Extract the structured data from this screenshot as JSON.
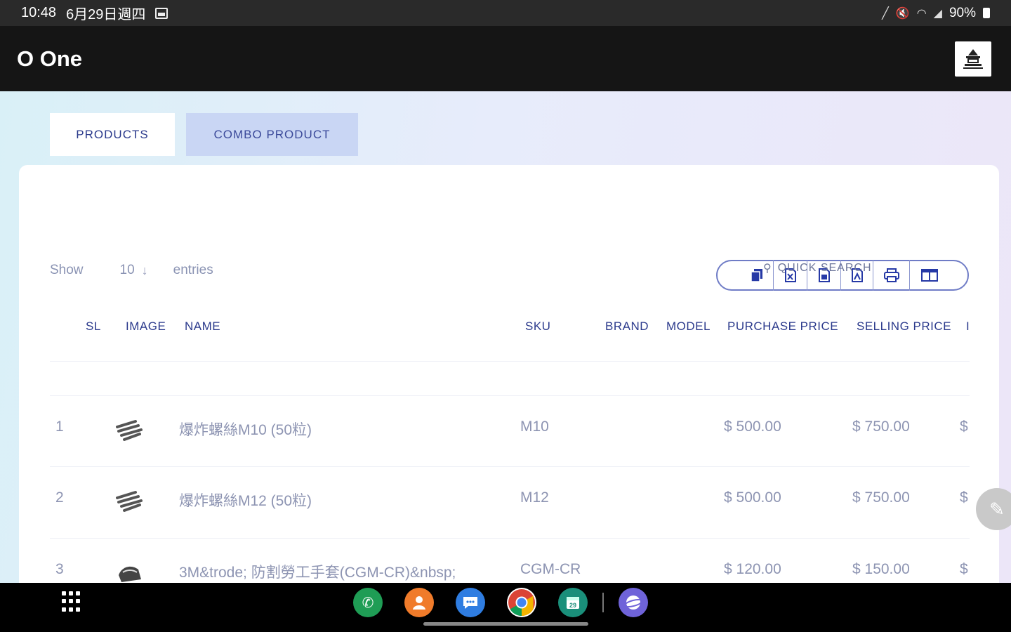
{
  "status_bar": {
    "time": "10:48",
    "date": "6月29日週四",
    "battery": "90%",
    "icons": [
      "gallery-icon",
      "mute-icon",
      "wifi-icon",
      "signal-icon",
      "battery-icon"
    ]
  },
  "header": {
    "title": "O One"
  },
  "tabs": [
    {
      "label": "PRODUCTS",
      "active": true
    },
    {
      "label": "COMBO PRODUCT",
      "active": false
    }
  ],
  "table_controls": {
    "show_label": "Show",
    "entries_value": "10",
    "entries_label": "entries",
    "search_placeholder": "QUICK SEARCH",
    "tools": [
      "copy-icon",
      "excel-icon",
      "csv-icon",
      "pdf-icon",
      "print-icon",
      "columns-icon"
    ]
  },
  "table": {
    "headers": [
      "SL",
      "IMAGE",
      "NAME",
      "SKU",
      "BRAND",
      "MODEL",
      "PURCHASE PRICE",
      "SELLING PRICE",
      "I"
    ],
    "rows": [
      {
        "sl": "1",
        "name": "爆炸螺絲M10 (50粒)",
        "sku": "M10",
        "brand": "",
        "model": "",
        "purchase_price": "$ 500.00",
        "selling_price": "$ 750.00",
        "more": "$"
      },
      {
        "sl": "2",
        "name": "爆炸螺絲M12 (50粒)",
        "sku": "M12",
        "brand": "",
        "model": "",
        "purchase_price": "$ 500.00",
        "selling_price": "$ 750.00",
        "more": "$"
      },
      {
        "sl": "3",
        "name": "3M&trode; 防割勞工手套(CGM-CR)&nbsp;",
        "sku": "CGM-CR",
        "brand": "",
        "model": "",
        "purchase_price": "$ 120.00",
        "selling_price": "$ 150.00",
        "more": "$"
      }
    ]
  },
  "nav_bar": {
    "dock_apps": [
      {
        "name": "phone",
        "color": "#1f9d55"
      },
      {
        "name": "contacts",
        "color": "#f07b2a"
      },
      {
        "name": "messages",
        "color": "#2f7de1"
      },
      {
        "name": "chrome",
        "color": "#ffffff"
      },
      {
        "name": "calendar",
        "color": "#1a8f7a"
      },
      {
        "name": "internet",
        "color": "#6f63d9"
      }
    ]
  }
}
